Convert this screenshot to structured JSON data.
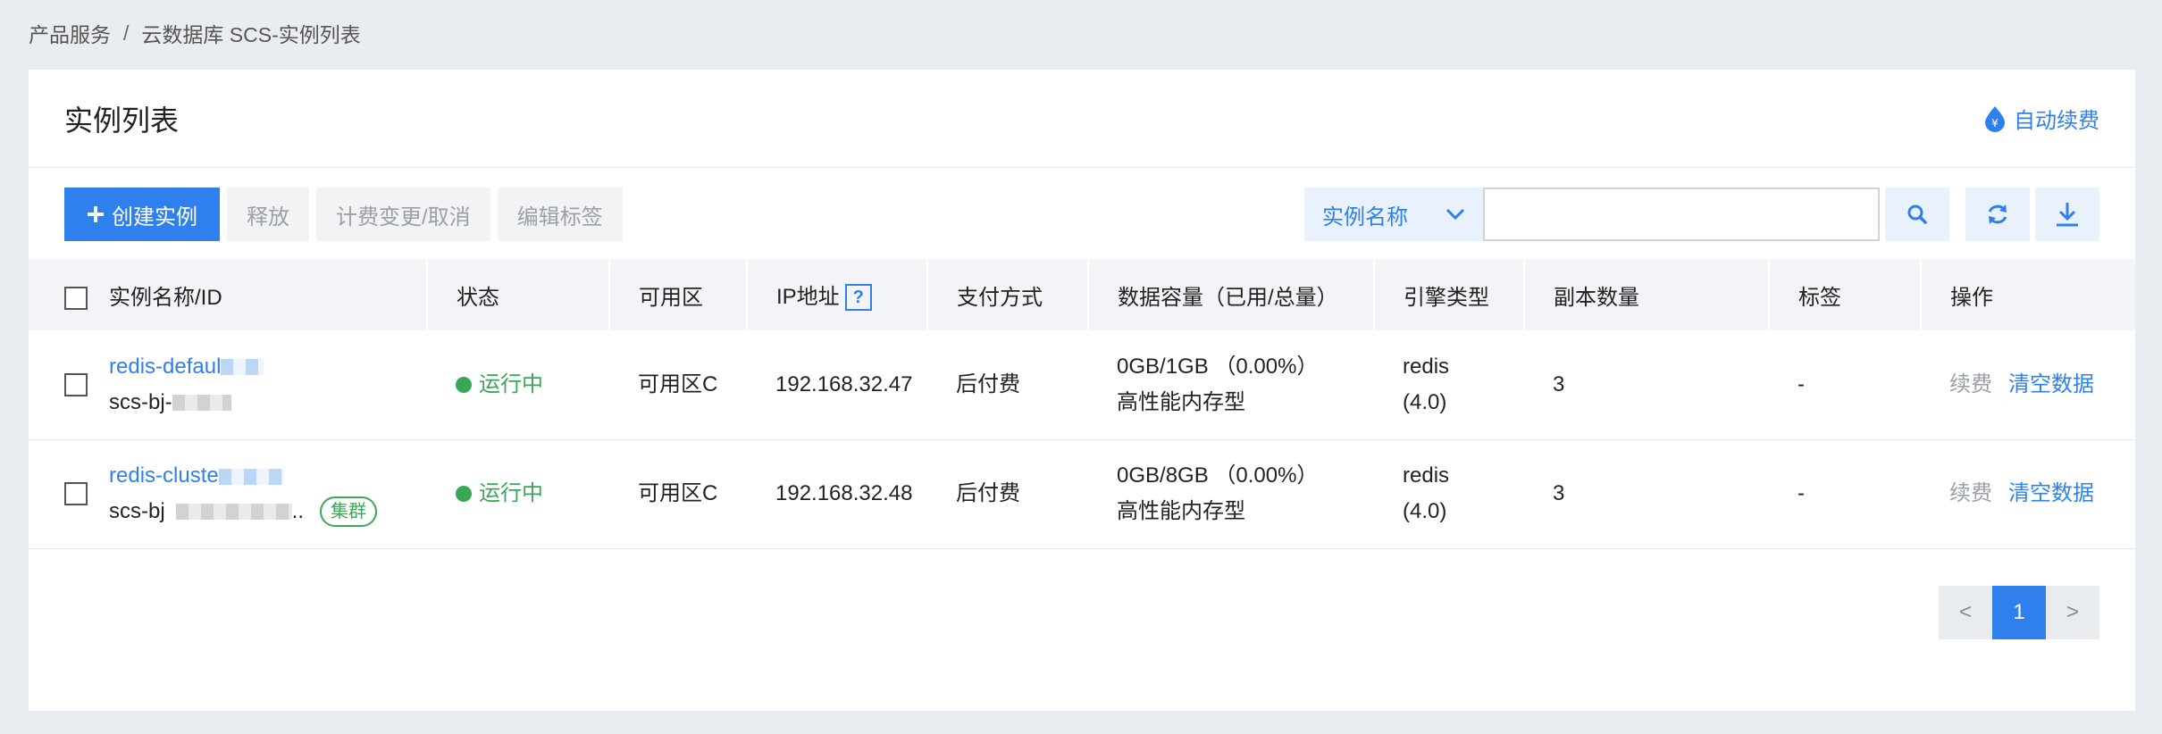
{
  "breadcrumb": {
    "parent": "产品服务",
    "separator": "/",
    "current": "云数据库 SCS-实例列表"
  },
  "card": {
    "title": "实例列表",
    "auto_renew": "自动续费"
  },
  "toolbar": {
    "create": "创建实例",
    "release": "释放",
    "billing_change": "计费变更/取消",
    "edit_tags": "编辑标签",
    "search_field": "实例名称",
    "search_placeholder": ""
  },
  "table": {
    "headers": [
      "实例名称/ID",
      "状态",
      "可用区",
      "IP地址",
      "支付方式",
      "数据容量（已用/总量）",
      "引擎类型",
      "副本数量",
      "标签",
      "操作"
    ],
    "help_mark": "?",
    "rows": [
      {
        "name": "redis-defaul",
        "id": "scs-bj-",
        "cluster_tag": "",
        "status": "运行中",
        "zone": "可用区C",
        "ip": "192.168.32.47",
        "payment": "后付费",
        "capacity": "0GB/1GB （0.00%）",
        "storage_type": "高性能内存型",
        "engine": "redis",
        "engine_version": "(4.0)",
        "replicas": "3",
        "tags": "-",
        "op_renew": "续费",
        "op_clear": "清空数据"
      },
      {
        "name": "redis-cluste",
        "id": "scs-bj",
        "id_suffix": "..",
        "cluster_tag": "集群",
        "status": "运行中",
        "zone": "可用区C",
        "ip": "192.168.32.48",
        "payment": "后付费",
        "capacity": "0GB/8GB （0.00%）",
        "storage_type": "高性能内存型",
        "engine": "redis",
        "engine_version": "(4.0)",
        "replicas": "3",
        "tags": "-",
        "op_renew": "续费",
        "op_clear": "清空数据"
      }
    ]
  },
  "pagination": {
    "prev": "<",
    "current": "1",
    "next": ">"
  },
  "colors": {
    "accent": "#2f80ed",
    "success": "#3aa757",
    "background": "#e9edf1"
  }
}
